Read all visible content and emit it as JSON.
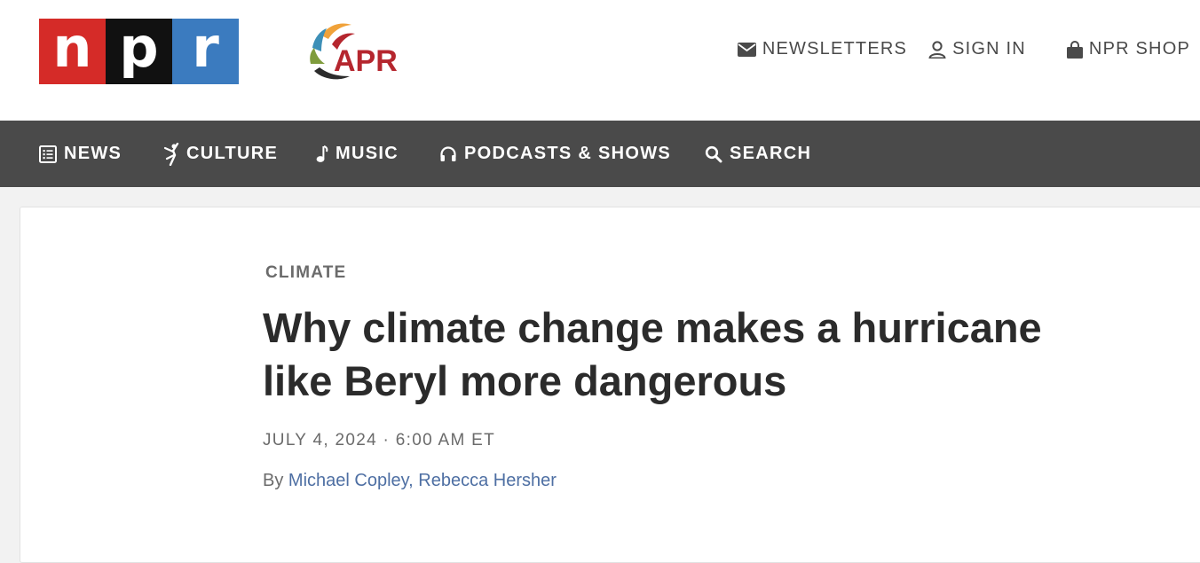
{
  "brand": {
    "npr_letters": [
      "n",
      "p",
      "r"
    ],
    "station": "APR",
    "colors": {
      "npr_red": "#d52b28",
      "npr_black": "#111111",
      "npr_blue": "#3b7bbf",
      "apr_red": "#b5262e"
    }
  },
  "utility": {
    "newsletters": "NEWSLETTERS",
    "sign_in": "SIGN IN",
    "shop": "NPR SHOP"
  },
  "nav": {
    "news": "NEWS",
    "culture": "CULTURE",
    "music": "MUSIC",
    "podcasts": "PODCASTS & SHOWS",
    "search": "SEARCH"
  },
  "article": {
    "slug": "CLIMATE",
    "headline": "Why climate change makes a hurricane like Beryl more dangerous",
    "dateline": "JULY 4, 2024 · 6:00 AM ET",
    "by_prefix": "By",
    "authors": [
      "Michael Copley",
      "Rebecca Hersher"
    ],
    "author_sep": ","
  },
  "icons": {
    "newsletters": "envelope-icon",
    "sign_in": "user-icon",
    "shop": "shopping-bag-icon",
    "news": "newspaper-icon",
    "culture": "dancer-icon",
    "music": "music-note-icon",
    "podcasts": "headphones-icon",
    "search": "search-icon"
  }
}
